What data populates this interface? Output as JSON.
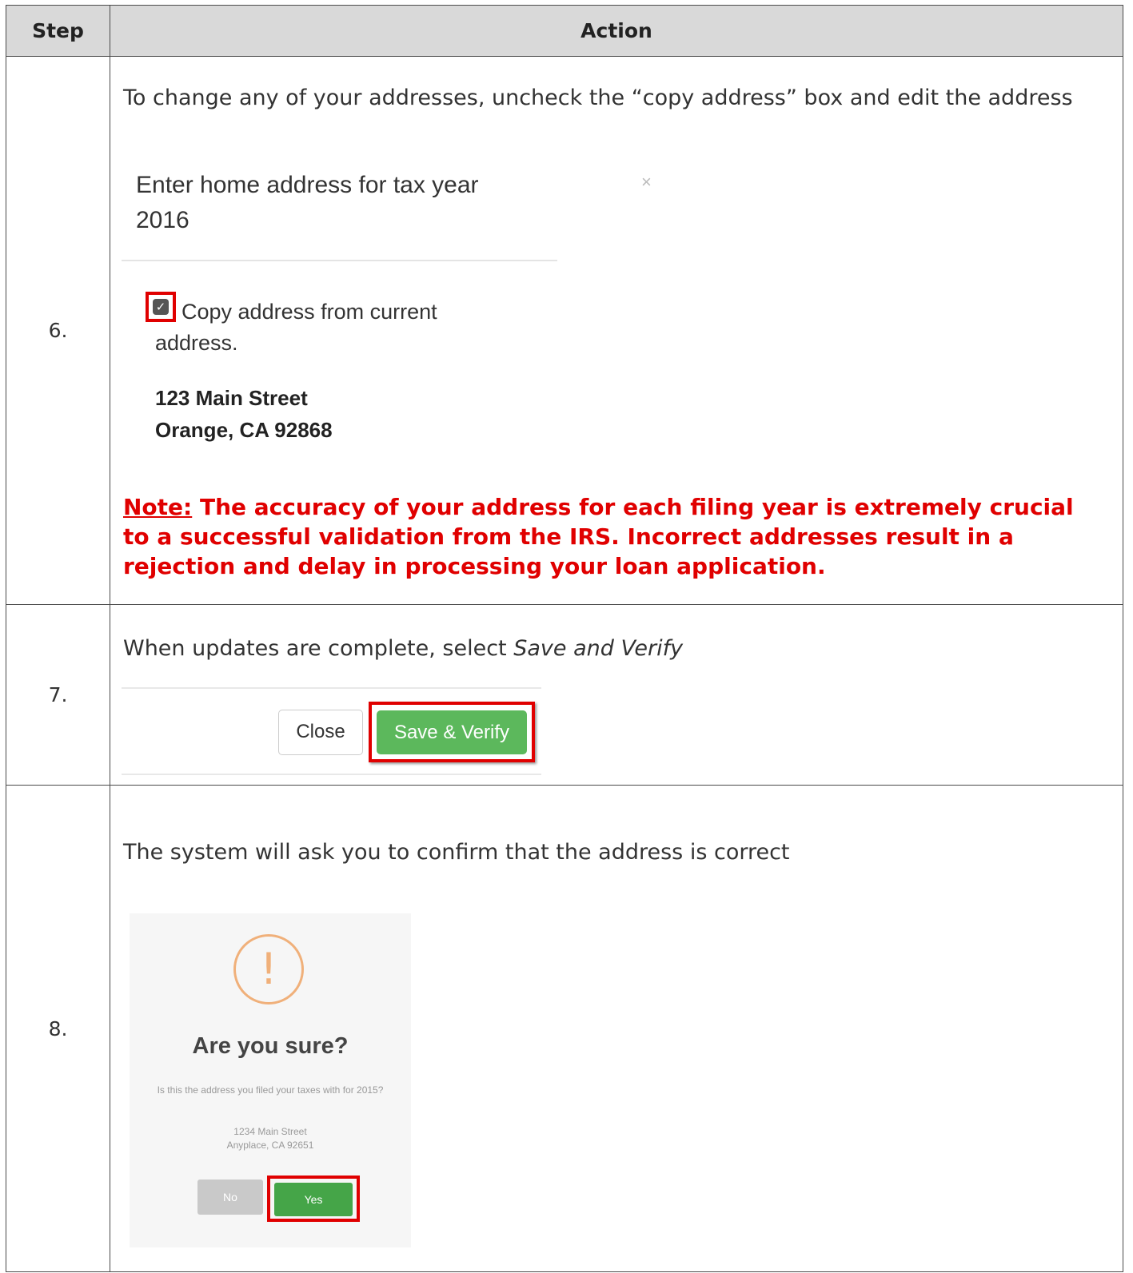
{
  "table": {
    "headers": {
      "step": "Step",
      "action": "Action"
    }
  },
  "step6": {
    "number": "6.",
    "instruction": "To change any of your addresses, uncheck the “copy address” box and edit the address",
    "modal_title": "Enter home address for tax year 2016",
    "close_glyph": "×",
    "checkbox_label_line1": "Copy address from current",
    "checkbox_label_line2": "address.",
    "checkbox_checked": true,
    "address_line1": "123 Main Street",
    "address_line2": "Orange, CA 92868",
    "note_label": "Note:",
    "note_text": " The accuracy of your address for each filing year is extremely crucial to a successful validation from the IRS. Incorrect addresses result in a rejection and delay in processing your loan application."
  },
  "step7": {
    "number": "7.",
    "instruction_prefix": "When updates are complete, select ",
    "instruction_emphasis": "Save and Verify",
    "close_button": "Close",
    "save_button": "Save & Verify"
  },
  "step8": {
    "number": "8.",
    "instruction": "The system will ask you to confirm that the address is correct",
    "dialog_icon": "!",
    "dialog_title": "Are you sure?",
    "dialog_text": "Is this the address you filed your taxes with for 2015?",
    "dialog_address_line1": "1234 Main Street",
    "dialog_address_line2": "Anyplace, CA 92651",
    "no_button": "No",
    "yes_button": "Yes"
  },
  "colors": {
    "highlight_red": "#e00000",
    "success_green": "#5cb85c",
    "warning_orange": "#f0b07a",
    "header_gray": "#d9d9d9"
  }
}
